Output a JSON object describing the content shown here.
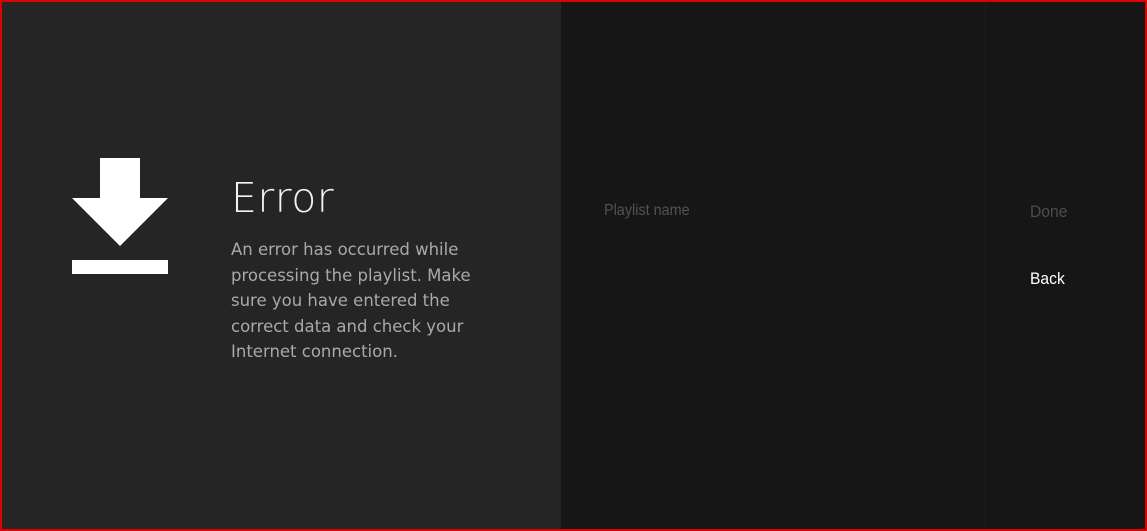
{
  "error": {
    "icon": "download-icon",
    "title": "Error",
    "message": "An error has occurred while processing the playlist. Make sure you have entered the correct data and check your Internet connection."
  },
  "form": {
    "playlist_name_label": "Playlist name"
  },
  "actions": {
    "done_label": "Done",
    "back_label": "Back"
  },
  "colors": {
    "frame_border": "#e00000",
    "left_panel_bg": "#252525",
    "right_panel_bg": "#161616",
    "title_text": "#f2f2f2",
    "message_text": "#a9a9a9",
    "disabled_text": "#4d4d4d",
    "active_text": "#ffffff"
  }
}
